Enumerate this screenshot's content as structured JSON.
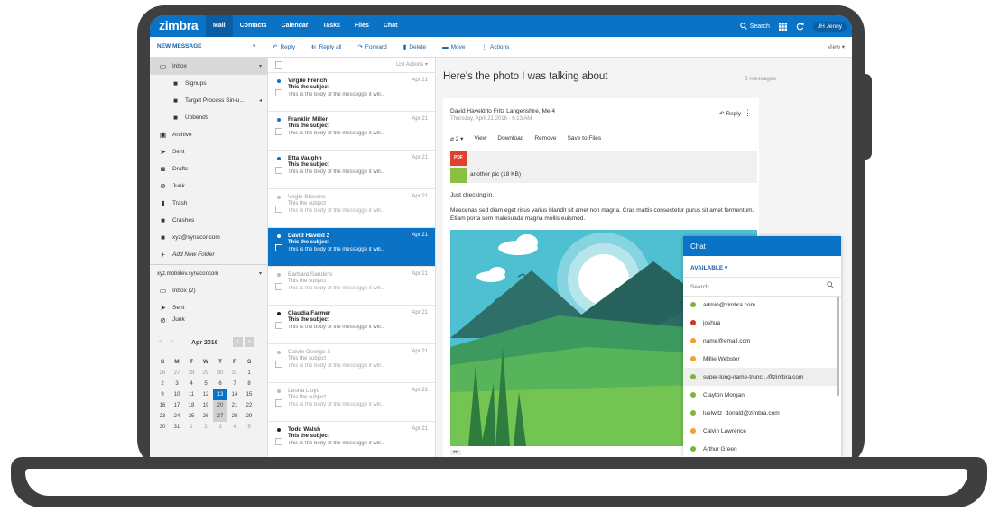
{
  "app": {
    "logo": "zimbra"
  },
  "topnav": [
    {
      "label": "Mail",
      "active": true
    },
    {
      "label": "Contacts",
      "active": false
    },
    {
      "label": "Calendar",
      "active": false
    },
    {
      "label": "Tasks",
      "active": false
    },
    {
      "label": "Files",
      "active": false
    },
    {
      "label": "Chat",
      "active": false
    }
  ],
  "topright": {
    "search": "Search",
    "user": "JH Jenny"
  },
  "toolbar": {
    "new_message": "NEW MESSAGE",
    "reply": "Reply",
    "reply_all": "Reply all",
    "forward": "Forward",
    "delete": "Delete",
    "move": "Move",
    "actions": "Actions",
    "view": "View"
  },
  "sidebar": {
    "items": [
      {
        "label": "Inbox",
        "icon": "inbox-icon"
      },
      {
        "label": "Signups",
        "icon": "folder-icon"
      },
      {
        "label": "Target Process Sin-u...",
        "icon": "folder-icon"
      },
      {
        "label": "Upbends",
        "icon": "folder-icon"
      },
      {
        "label": "Archive",
        "icon": "archive-icon"
      },
      {
        "label": "Sent",
        "icon": "sent-icon"
      },
      {
        "label": "Drafts",
        "icon": "drafts-icon"
      },
      {
        "label": "Junk",
        "icon": "junk-icon"
      },
      {
        "label": "Trash",
        "icon": "trash-icon"
      },
      {
        "label": "Crashes",
        "icon": "folder-icon"
      },
      {
        "label": "xyz@synacor.com",
        "icon": "folder-icon"
      },
      {
        "label": "Add New Folder",
        "icon": "plus-icon"
      }
    ],
    "account2": {
      "label": "xyz.mobidev.synacor.com",
      "items": [
        {
          "label": "Inbox (2)",
          "icon": "inbox-icon"
        },
        {
          "label": "Sent",
          "icon": "sent-icon"
        },
        {
          "label": "Junk",
          "icon": "junk-icon"
        }
      ]
    }
  },
  "calendar": {
    "title": "Apr 2016",
    "dow": [
      "S",
      "M",
      "T",
      "W",
      "T",
      "F",
      "S"
    ],
    "weeks": [
      [
        "26",
        "27",
        "28",
        "29",
        "30",
        "31",
        "1"
      ],
      [
        "2",
        "3",
        "4",
        "5",
        "6",
        "7",
        "8"
      ],
      [
        "9",
        "10",
        "11",
        "12",
        "13",
        "14",
        "15"
      ],
      [
        "16",
        "17",
        "18",
        "19",
        "20",
        "21",
        "22"
      ],
      [
        "23",
        "24",
        "25",
        "26",
        "27",
        "28",
        "29"
      ],
      [
        "30",
        "31",
        "1",
        "2",
        "3",
        "4",
        "5"
      ]
    ],
    "today": "13",
    "selected": [
      "20",
      "27"
    ]
  },
  "messagelist": {
    "header": "List Actions",
    "messages": [
      {
        "sender": "Virgile French",
        "date": "Apr 21",
        "subject": "This the subject",
        "body": "This is the body of the messegge it will...",
        "state": "unread"
      },
      {
        "sender": "Franklin Miller",
        "date": "Apr 21",
        "subject": "This the subject",
        "body": "This is the body of the messegge it will...",
        "state": "unread"
      },
      {
        "sender": "Etta Vaughn",
        "date": "Apr 21",
        "subject": "This the subject",
        "body": "This is the body of the messegge it will...",
        "state": "unread"
      },
      {
        "sender": "Virgle Stevens",
        "date": "Apr 21",
        "subject": "This the subject",
        "body": "This is the body of the messegge it will...",
        "state": "read"
      },
      {
        "sender": "David Haveld 2",
        "date": "Apr 21",
        "subject": "This the subject",
        "body": "This is the body of the messegge it will...",
        "state": "selected"
      },
      {
        "sender": "Barbara Sanders",
        "date": "Apr 21",
        "subject": "This the subject",
        "body": "This is the body of the messegge it will...",
        "state": "read"
      },
      {
        "sender": "Claudia Farmer",
        "date": "Apr 21",
        "subject": "This the subject",
        "body": "This is the body of the messegge it will...",
        "state": "unread"
      },
      {
        "sender": "Calvin George 2",
        "date": "Apr 21",
        "subject": "This the subject",
        "body": "This is the body of the messegge it will...",
        "state": "read"
      },
      {
        "sender": "Leona Lloyd",
        "date": "Apr 21",
        "subject": "This the subject",
        "body": "This is the body of the messegge it will...",
        "state": "read"
      },
      {
        "sender": "Todd Walsh",
        "date": "Apr 21",
        "subject": "This the subject",
        "body": "This is the body of the messegge it will...",
        "state": "unread"
      }
    ]
  },
  "reading": {
    "title": "Here's the photo I was talking about",
    "count": "3 messages",
    "from": "David Haveld  to  Fritz Langenshire, Me 4",
    "when": "Thursday, April 21 2016 - 6:13 AM",
    "reply": "Reply",
    "attach_count": "2",
    "attach_actions": [
      "View",
      "Download",
      "Remove",
      "Save to Files"
    ],
    "pdf_label": "PDF",
    "attachment_name": "another pic (18 KB)",
    "greeting": "Just checking in.",
    "paragraph": "Maecenas sed diam eget risus varius blandit sit amet non magna. Cras mattis consectetur purus sit amet fermentum. Etiam porta sem malesuada magna mollis euismod.",
    "more": "•••"
  },
  "chat": {
    "title": "Chat",
    "status": "AVAILABLE",
    "search_placeholder": "Search",
    "contacts": [
      {
        "name": "admin@zimbra.com",
        "status_color": "#7cb342"
      },
      {
        "name": "joshua",
        "status_color": "#d32f2f"
      },
      {
        "name": "name@email.com",
        "status_color": "#f0a030"
      },
      {
        "name": "Millie Webster",
        "status_color": "#f0a030"
      },
      {
        "name": "super-long-name-trunc...@zimbra.com",
        "status_color": "#7cb342"
      },
      {
        "name": "Clayton Morgan",
        "status_color": "#7cb342"
      },
      {
        "name": "luelwitz_donald@zimbra.com",
        "status_color": "#7cb342"
      },
      {
        "name": "Calvin Lawrence",
        "status_color": "#f0a030"
      },
      {
        "name": "Arthur Green",
        "status_color": "#7cb342"
      }
    ]
  },
  "colors": {
    "accent": "#0b73c6",
    "unread_dot": "#0b73c6",
    "laptop": "#3e3f41"
  }
}
